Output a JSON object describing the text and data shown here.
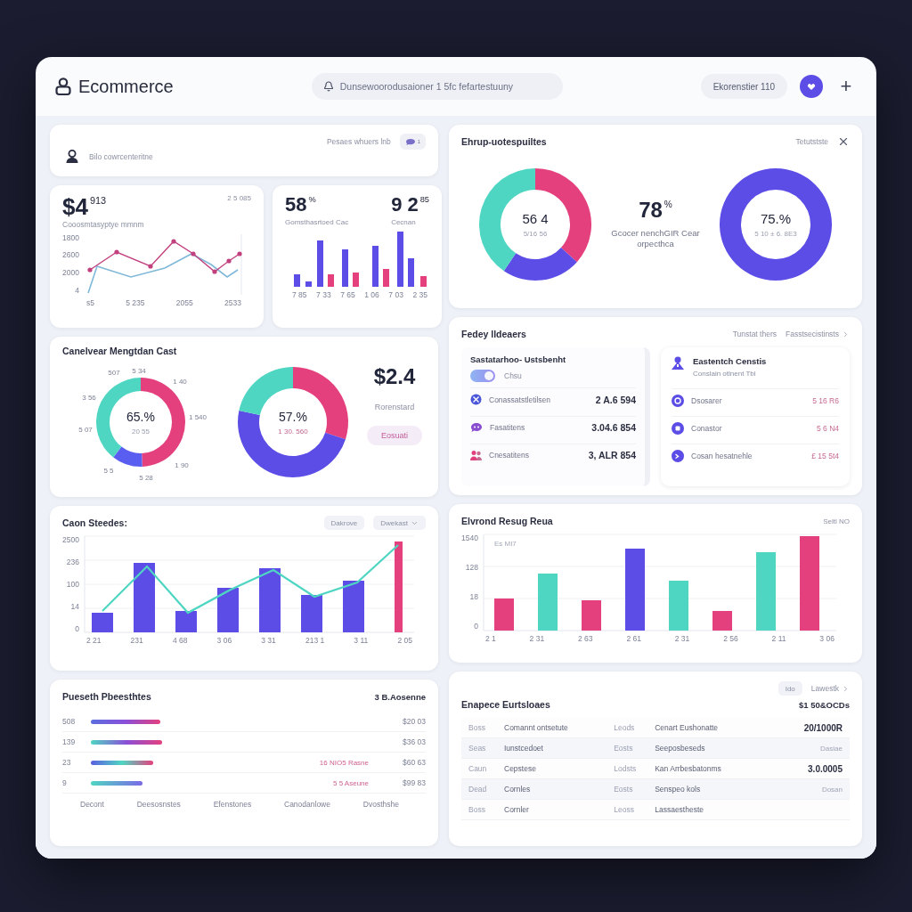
{
  "header": {
    "title": "Ecommerce",
    "search": {
      "placeholder": "Dunsewoorodusaioner 1 5fc fefartestuuny"
    },
    "account": "Ekorenstier 110",
    "add": "+"
  },
  "welcome": {
    "link": "Pesaes whuers lnb",
    "badge": "1",
    "user": "Bilo cowrcenteritne"
  },
  "revenue": {
    "value": "$4",
    "small": "913",
    "corner": "2 5 085",
    "subtitle": "Cooosmtasyptye mmnm",
    "y_labels": [
      "1800",
      "2600",
      "2000",
      "4"
    ],
    "x_labels": [
      "s5",
      "5 235",
      "2055",
      "2533"
    ]
  },
  "conversion": {
    "stats": [
      {
        "value": "58",
        "small": "%",
        "label": "Gomsthasrtoed Cac"
      },
      {
        "value": "9 2",
        "small": "85",
        "label": "Cecnan"
      }
    ],
    "x_labels": [
      "7 85",
      "7 33",
      "7 65",
      "1 06",
      "7 03",
      "2 35"
    ]
  },
  "segments": {
    "title": "Ehrup-uotespuiltes",
    "action": "Tetutstste",
    "donut": {
      "value": "56 4",
      "caption": "5/16 56"
    },
    "stat": {
      "value": "78",
      "small": "%",
      "caption": "Gcocer nenchGIR Cear orpecthca"
    },
    "ring": {
      "value": "75.%",
      "caption": "5 10 ± 6. 8E3"
    }
  },
  "audience": {
    "title": "Canelvear Mengtdan Cast",
    "donut": {
      "value": "65.%",
      "caption": "20 55",
      "labels": [
        "507",
        "5 34",
        "1 40",
        "3 56",
        "5 07",
        "1 540",
        "5 5",
        "5 28",
        "1 90"
      ]
    },
    "donut2": {
      "value": "57.%",
      "caption": "1 30. 560"
    },
    "amount": "$2.4",
    "amount_label": "Rorenstard",
    "button": "Eosuati"
  },
  "details": {
    "title": "Fedey lldeaers",
    "links": [
      "Tunstat thers",
      "Fasstsecistinsts"
    ],
    "left": {
      "title": "Sastatarhoo- Ustsbenht",
      "toggle": {
        "on": true,
        "label": "Chsu"
      },
      "rows": [
        {
          "label": "Conassatstletilsen",
          "value": "2 A.6 594"
        },
        {
          "label": "Fasatitens",
          "value": "3.04.6 854"
        },
        {
          "label": "Cnesatitens",
          "value": "3, ALR 854"
        }
      ]
    },
    "right": {
      "title": "Eastentch Censtis",
      "subtitle": "Conslain otlnent Tbl",
      "rows": [
        {
          "label": "Dsosarer",
          "value": "5 16 R6"
        },
        {
          "label": "Conastor",
          "value": "5 6 N4"
        },
        {
          "label": "Cosan hesatnehle",
          "value": "£ 15 5t4"
        }
      ]
    }
  },
  "sales_chart": {
    "title": "Caon Steedes:",
    "buttons": [
      "Dakrove",
      "Dwekast"
    ],
    "y_labels": [
      "2500",
      "236",
      "100",
      "14",
      "0"
    ],
    "x_labels": [
      "2 21",
      "231",
      "4 68",
      "3 06",
      "3 31",
      "213 1",
      "3 11",
      "2 05"
    ]
  },
  "orders_chart": {
    "title": "Elvrond Resug Reua",
    "corner": "Seltl NO",
    "note": "Es MI7",
    "y_labels": [
      "1540",
      "128",
      "18",
      "0"
    ],
    "x_labels": [
      "2 1",
      "2 31",
      "2 63",
      "2 61",
      "2 31",
      "2 56",
      "2 11",
      "3 06"
    ]
  },
  "products": {
    "title": "Pueseth Pbeesthtes",
    "total": "3 B.Aosenne",
    "rows": [
      {
        "label": "508",
        "value": "$20 03"
      },
      {
        "label": "139",
        "value": "$36 03"
      },
      {
        "label": "23",
        "note": "16 NIO5 Rasne",
        "value": "$60 63"
      },
      {
        "label": "9",
        "note": "5 5 Aseune",
        "value": "$99 83"
      }
    ],
    "x_labels": [
      "Decont",
      "Deesosnstes",
      "Efenstones",
      "Canodanlowe",
      "Dvosthshe"
    ]
  },
  "table": {
    "chip": "Ido",
    "link": "Lawestk",
    "title": "Enapece Eurtsloaes",
    "total": "$1 50&OCDs",
    "rows": [
      {
        "cells": [
          "Boss",
          "Comannt ontsetute",
          "Leods",
          "Cenart Eushonatte"
        ],
        "amount": "20/1000R",
        "muted": false
      },
      {
        "cells": [
          "Seas",
          "Iunstcedoet",
          "Eosts",
          "Seeposbeseds"
        ],
        "amount": "Dasiae",
        "muted": true
      },
      {
        "cells": [
          "Caun",
          "Cepstese",
          "Lodsts",
          "Kan Arrbesbatonms"
        ],
        "amount": "3.0.0005",
        "muted": false
      },
      {
        "cells": [
          "Dead",
          "Cornles",
          "Eosts",
          "Senspeo kols"
        ],
        "amount": "Dosan",
        "muted": true
      },
      {
        "cells": [
          "Boss",
          "Cornler",
          "Leoss",
          "Lassaestheste"
        ]
      }
    ]
  }
}
